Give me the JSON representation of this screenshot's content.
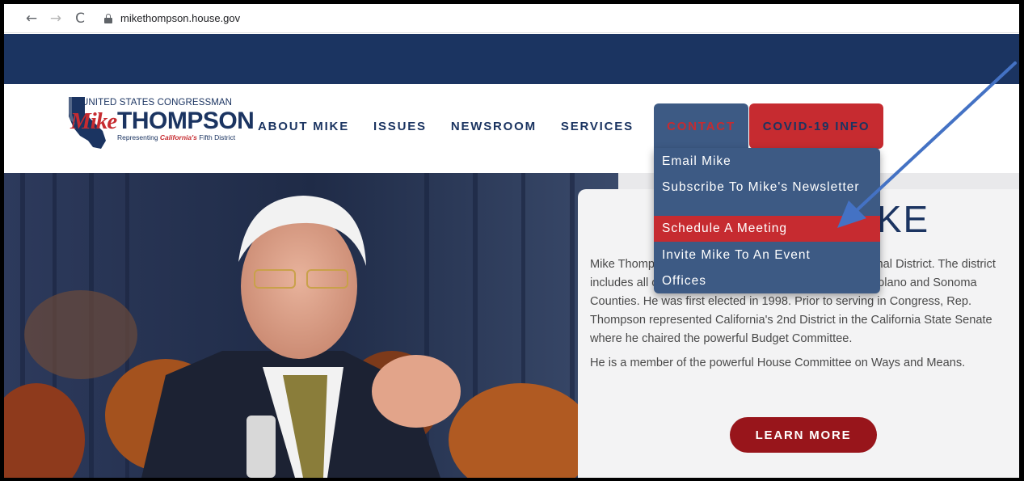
{
  "browser": {
    "back_icon": "←",
    "forward_icon": "→",
    "reload_icon": "C",
    "url": "mikethompson.house.gov"
  },
  "logo": {
    "line1": "UNITED STATES CONGRESSMAN",
    "first": "Mike",
    "last": "THOMPSON",
    "tagline_pre": "Representing ",
    "tagline_state": "California's",
    "tagline_post": " Fifth District"
  },
  "nav": {
    "items": [
      "ABOUT MIKE",
      "ISSUES",
      "NEWSROOM",
      "SERVICES"
    ],
    "contact": "CONTACT",
    "covid": "COVID-19 INFO"
  },
  "dropdown": {
    "items": [
      "Email Mike",
      "Subscribe To Mike's Newsletter",
      "Schedule A Meeting",
      "Invite Mike To An Event",
      "Offices"
    ],
    "active_index": 2
  },
  "meet": {
    "title": "MEET MIKE",
    "paragraph1": "Mike Thompson represents California's 5th Congressional District. The district includes all of Napa and parts of Contra Costa, Lake, Solano and Sonoma Counties. He was first elected in 1998. Prior to serving in Congress, Rep. Thompson represented California's 2nd District in the California State Senate where he chaired the powerful Budget Committee.",
    "paragraph2": "He is a member of the powerful House Committee on Ways and Means.",
    "button": "LEARN MORE"
  },
  "colors": {
    "navy": "#1b3461",
    "red": "#c62b30",
    "dropdown": "#3d5a84",
    "button": "#98151b",
    "annotation_arrow": "#4472c4"
  },
  "icons": {
    "lock": "lock-icon",
    "back": "arrow-left-icon",
    "forward": "arrow-right-icon",
    "reload": "reload-icon"
  }
}
